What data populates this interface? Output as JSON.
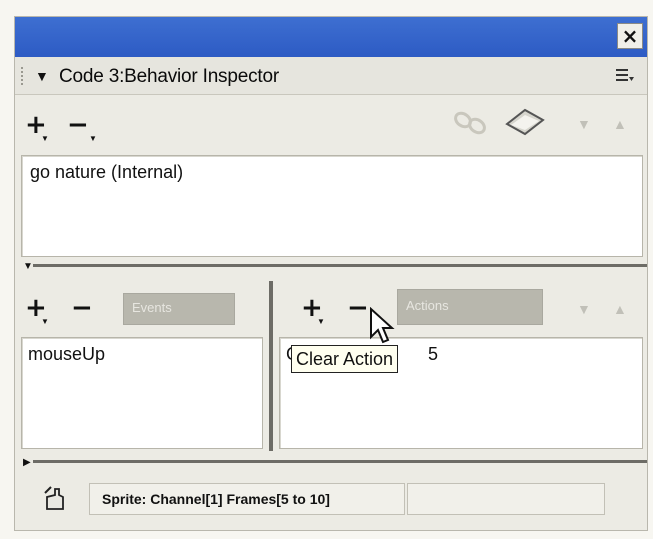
{
  "window": {
    "close_glyph": "×"
  },
  "header": {
    "title": "Code 3:Behavior Inspector",
    "options_icon": "options-menu-icon"
  },
  "behavior_toolbar": {
    "add_glyph": "+",
    "remove_glyph": "−"
  },
  "behaviors_list": {
    "items": [
      "go nature (Internal)"
    ]
  },
  "events_panel": {
    "add_glyph": "+",
    "remove_glyph": "−",
    "label": "Events",
    "items": [
      "mouseUp"
    ]
  },
  "actions_panel": {
    "add_glyph": "+",
    "remove_glyph": "−",
    "label": "Actions",
    "item_prefix": "G",
    "item_suffix": "5"
  },
  "tooltip": {
    "text": "Clear Action"
  },
  "status_bar": {
    "text": "Sprite:  Channel[1]  Frames[5 to 10]"
  }
}
